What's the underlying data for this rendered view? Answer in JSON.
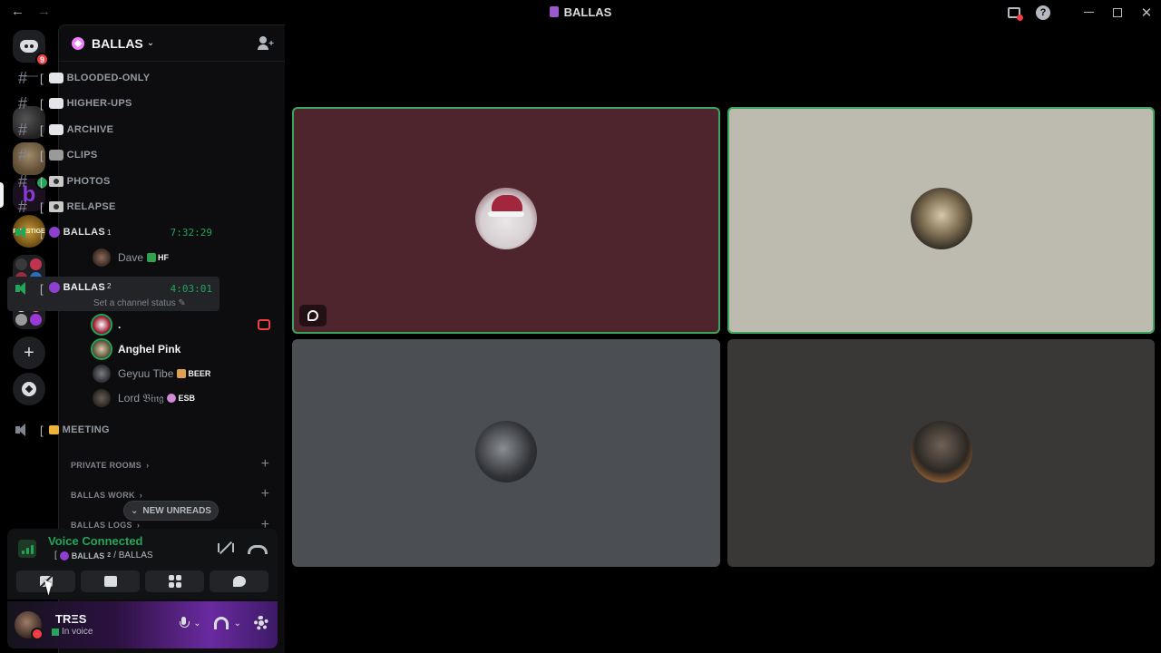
{
  "titlebar": {
    "title": "BALLAS",
    "back": "←",
    "forward": "→",
    "help": "?",
    "close": "✕"
  },
  "rail": {
    "unread_badge": "9",
    "add_symbol": "+",
    "active_server_letter": "b",
    "prestige_label": "PRESTIGE"
  },
  "server": {
    "name": "BALLAS",
    "caret": "⌄",
    "invite_plus": "+"
  },
  "channels": [
    {
      "bracket": "[",
      "name": "BLOODED-ONLY"
    },
    {
      "bracket": "[",
      "name": "HIGHER-UPS"
    },
    {
      "bracket": "[",
      "name": "ARCHIVE"
    },
    {
      "bracket": "[",
      "name": "CLIPS"
    },
    {
      "bracket": "[",
      "name": "PHOTOS"
    },
    {
      "bracket": "[",
      "name": "RELAPSE"
    }
  ],
  "voice_channels": {
    "ballas1": {
      "bracket": "[",
      "name": "BALLAS",
      "sup": "1",
      "timer": "7:32:29"
    },
    "ballas2": {
      "bracket": "[",
      "name": "BALLAS",
      "sup": "2",
      "timer": "4:03:01",
      "status_placeholder": "Set a channel status ✎"
    },
    "meeting": {
      "bracket": "[",
      "name": "MEETING"
    }
  },
  "voice_users": {
    "dave": {
      "name": "Dave",
      "tag": "HF"
    },
    "dot": {
      "name": "."
    },
    "anghel": {
      "name": "Anghel Pink"
    },
    "geyuu": {
      "name": "Geyuu Tibe",
      "tag": "BEER"
    },
    "lord": {
      "name": "Lord 𝔅𝔦𝔫𝔤",
      "tag": "ESB"
    }
  },
  "categories": [
    {
      "name": "PRIVATE ROOMS",
      "chevron": "›",
      "plus": "+"
    },
    {
      "name": "BALLAS WORK",
      "chevron": "›",
      "plus": "+"
    },
    {
      "name": "BALLAS LOGS",
      "chevron": "›",
      "plus": "+"
    }
  ],
  "new_unreads": {
    "chevron": "⌄",
    "label": "NEW UNREADS"
  },
  "voice_panel": {
    "title": "Voice Connected",
    "bracket": "[",
    "channel_short": "BALLAS",
    "sup": "2",
    "path": "/ BALLAS"
  },
  "user_panel": {
    "name": "TRΞS",
    "status": "In voice",
    "caret": "⌄"
  },
  "tiles": [
    {
      "label": "participant-1",
      "speaking": true
    },
    {
      "label": "participant-2",
      "speaking": true
    },
    {
      "label": "participant-3",
      "speaking": false
    },
    {
      "label": "participant-4",
      "speaking": false
    }
  ],
  "colors": {
    "speaking_border": "#3ba55d",
    "voice_green": "#23a55a",
    "danger": "#f23f43",
    "tile1": "#4f252d",
    "tile2": "#bdbbaf",
    "tile3": "#4b4e52",
    "tile4": "#393836"
  }
}
